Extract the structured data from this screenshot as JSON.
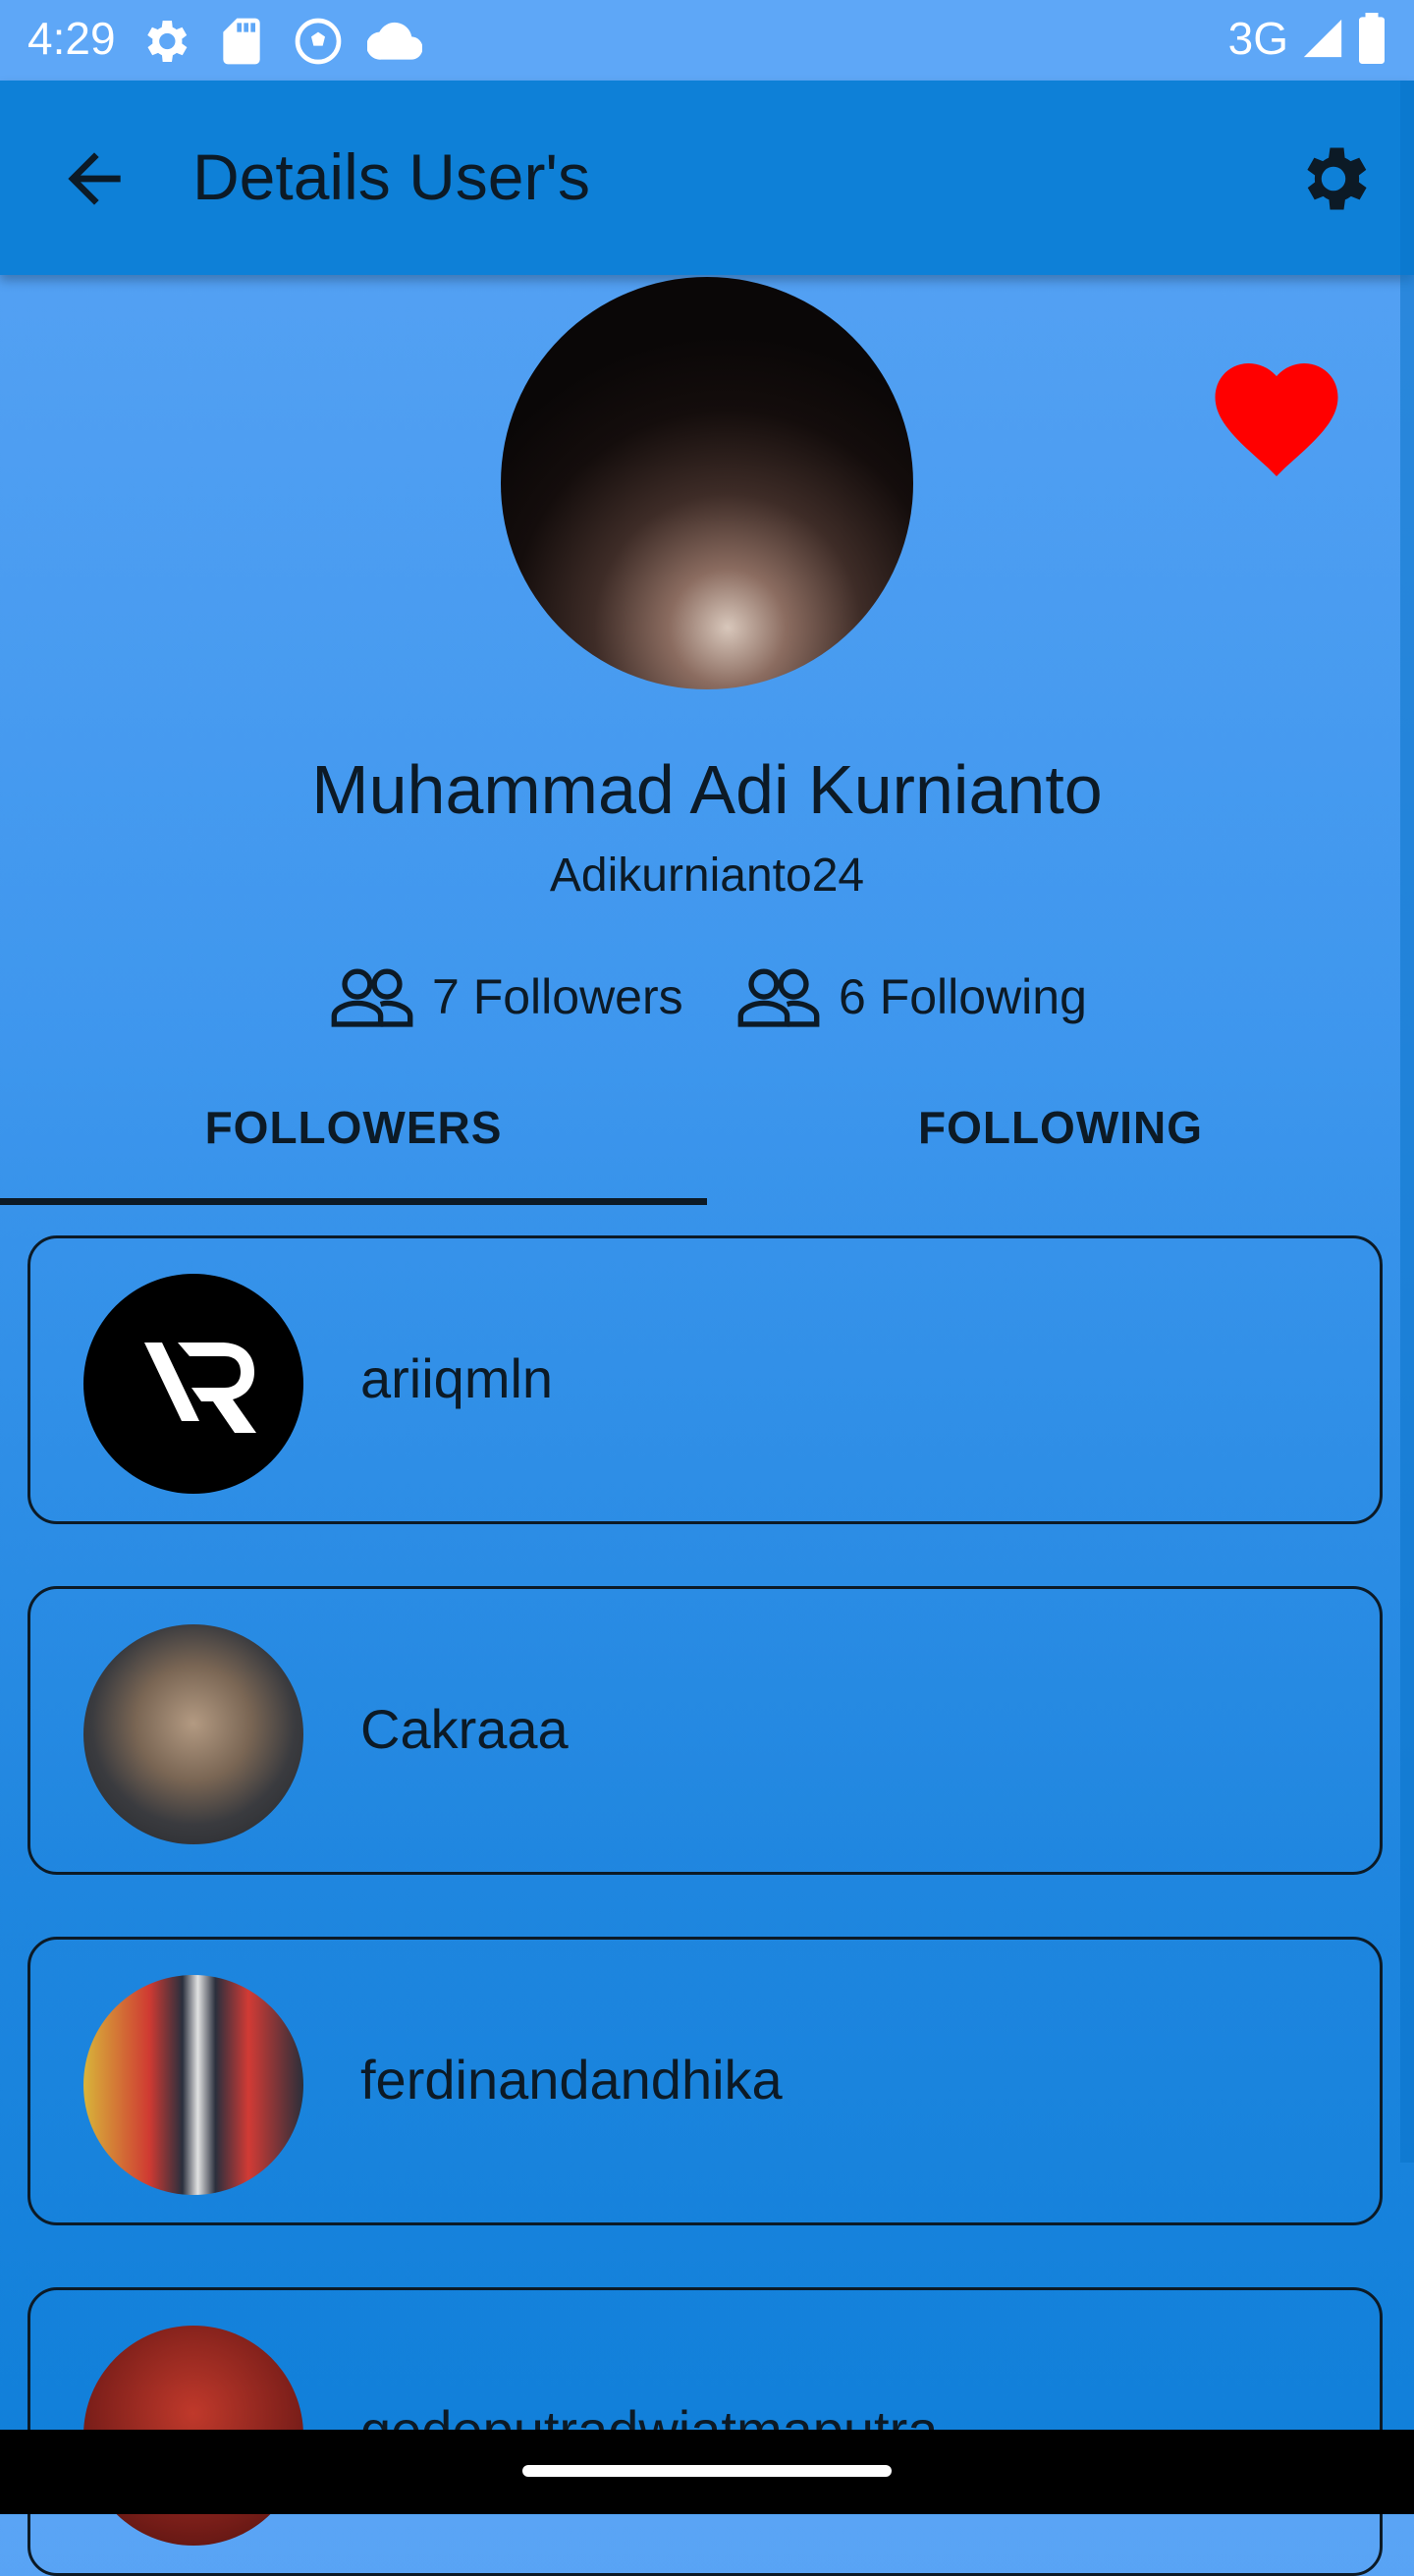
{
  "status_bar": {
    "time": "4:29",
    "network": "3G",
    "icons": [
      "settings-gear-icon",
      "sd-card-icon",
      "football-icon",
      "cloud-icon",
      "signal-icon",
      "battery-icon"
    ]
  },
  "app_bar": {
    "title": "Details User's",
    "background": "#0e80d7"
  },
  "profile": {
    "name": "Muhammad Adi Kurnianto",
    "login": "Adikurnianto24",
    "followers_label": "7 Followers",
    "following_label": "6 Following",
    "favorite_color": "#ff0000"
  },
  "tabs": {
    "followers": "FOLLOWERS",
    "following": "FOLLOWING",
    "selected": "FOLLOWERS"
  },
  "followers": [
    {
      "username": "ariiqmln"
    },
    {
      "username": "Cakraaa"
    },
    {
      "username": "ferdinandandhika"
    },
    {
      "username": "gedeputradwiatmaputra"
    }
  ]
}
